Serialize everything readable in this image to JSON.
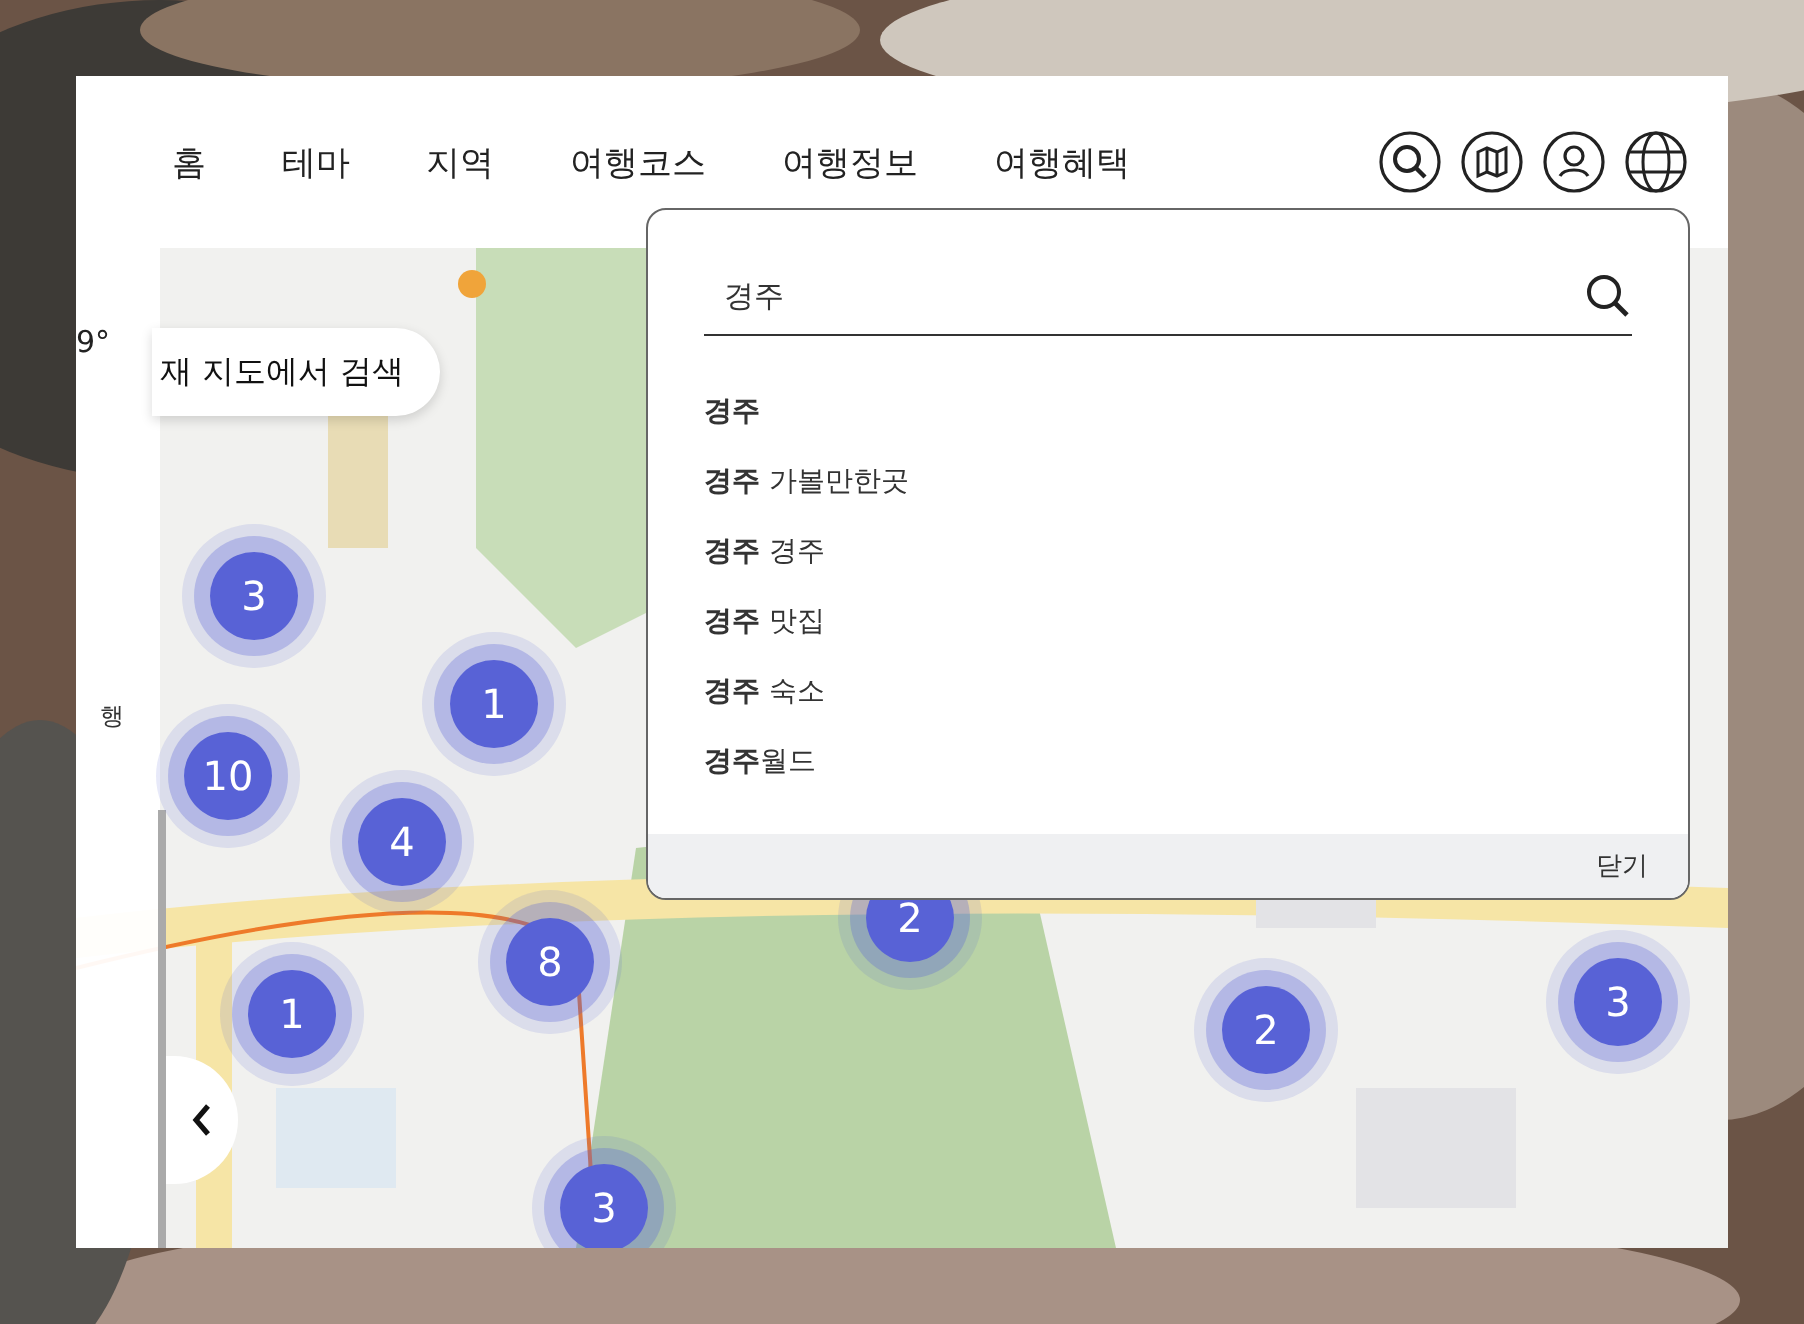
{
  "nav": [
    {
      "label": "홈"
    },
    {
      "label": "테마"
    },
    {
      "label": "지역"
    },
    {
      "label": "여행코스"
    },
    {
      "label": "여행정보"
    },
    {
      "label": "여행혜택"
    }
  ],
  "side_panel": {
    "temperature": "9°",
    "label": "행"
  },
  "map_search_button": {
    "label": "재 지도에서 검색"
  },
  "clusters": [
    {
      "count": "3"
    },
    {
      "count": "1"
    },
    {
      "count": "10"
    },
    {
      "count": "4"
    },
    {
      "count": "8"
    },
    {
      "count": "1"
    },
    {
      "count": "2"
    },
    {
      "count": "2"
    },
    {
      "count": "3"
    },
    {
      "count": "3"
    }
  ],
  "search": {
    "value": "경주"
  },
  "suggestions": [
    {
      "text": "**경주**"
    },
    {
      "text": "**경주** 가볼만한곳"
    },
    {
      "text": "**경주** 경주"
    },
    {
      "text": "**경주** 맛집"
    },
    {
      "text": "**경주** 숙소"
    },
    {
      "text": "**경주**월드"
    }
  ],
  "close_button": {
    "label": "닫기"
  }
}
